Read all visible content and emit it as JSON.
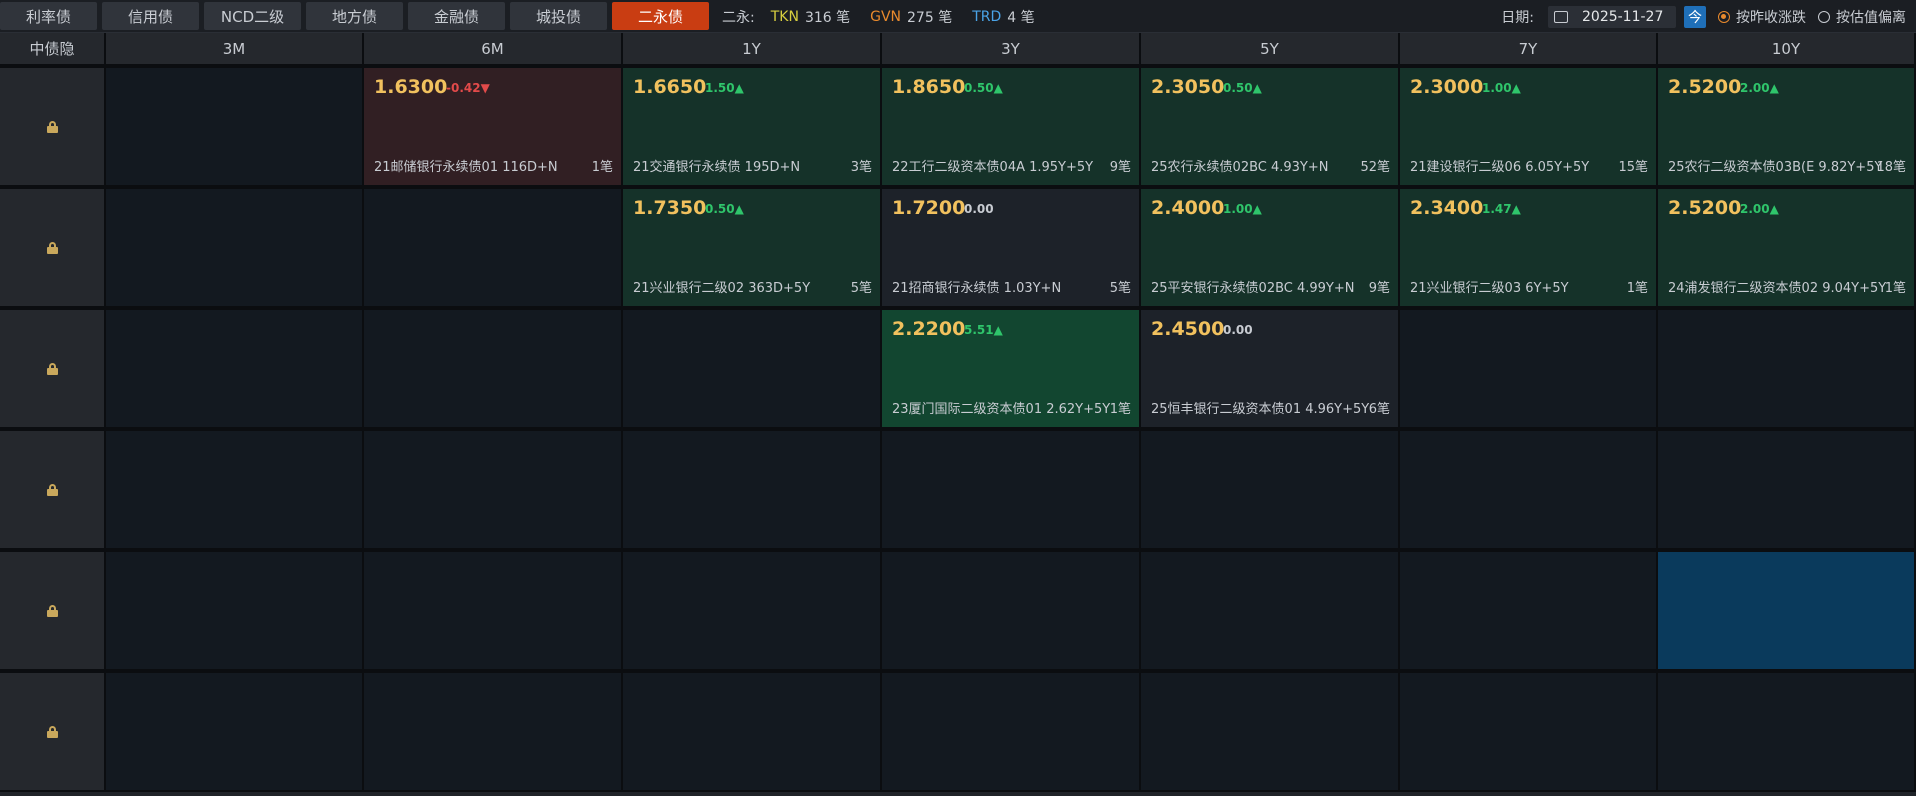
{
  "tabs": [
    "利率债",
    "信用债",
    "NCD二级",
    "地方债",
    "金融债",
    "城投债",
    "二永债"
  ],
  "active_tab": "二永债",
  "summary": {
    "label": "二永:",
    "tkn_key": "TKN",
    "tkn_val": "316 笔",
    "gvn_key": "GVN",
    "gvn_val": "275 笔",
    "trd_key": "TRD",
    "trd_val": "4 笔"
  },
  "date": {
    "label": "日期:",
    "value": "2025-11-27",
    "today_label": "今"
  },
  "options": [
    {
      "label": "按昨收涨跌",
      "selected": true
    },
    {
      "label": "按估值偏离",
      "selected": false
    }
  ],
  "grid": {
    "corner": "中债隐",
    "columns": [
      "3M",
      "6M",
      "1Y",
      "3Y",
      "5Y",
      "7Y",
      "10Y"
    ],
    "rows": [
      {
        "cells": [
          null,
          {
            "rate": "1.6300",
            "change": "-0.42▼",
            "dir": "down",
            "bond": "21邮储银行永续债01 116D+N",
            "count": "1笔"
          },
          {
            "rate": "1.6650",
            "change": "1.50▲",
            "dir": "up",
            "bond": "21交通银行永续债 195D+N",
            "count": "3笔"
          },
          {
            "rate": "1.8650",
            "change": "0.50▲",
            "dir": "up",
            "bond": "22工行二级资本债04A 1.95Y+5Y",
            "count": "9笔"
          },
          {
            "rate": "2.3050",
            "change": "0.50▲",
            "dir": "up",
            "bond": "25农行永续债02BC 4.93Y+N",
            "count": "52笔"
          },
          {
            "rate": "2.3000",
            "change": "1.00▲",
            "dir": "up",
            "bond": "21建设银行二级06 6.05Y+5Y",
            "count": "15笔"
          },
          {
            "rate": "2.5200",
            "change": "2.00▲",
            "dir": "up",
            "bond": "25农行二级资本债03B(E 9.82Y+5Y",
            "count": "18笔"
          }
        ]
      },
      {
        "cells": [
          null,
          null,
          {
            "rate": "1.7350",
            "change": "0.50▲",
            "dir": "up",
            "bond": "21兴业银行二级02 363D+5Y",
            "count": "5笔"
          },
          {
            "rate": "1.7200",
            "change": "0.00",
            "dir": "flat",
            "bond": "21招商银行永续债 1.03Y+N",
            "count": "5笔"
          },
          {
            "rate": "2.4000",
            "change": "1.00▲",
            "dir": "up",
            "bond": "25平安银行永续债02BC 4.99Y+N",
            "count": "9笔"
          },
          {
            "rate": "2.3400",
            "change": "1.47▲",
            "dir": "up",
            "bond": "21兴业银行二级03 6Y+5Y",
            "count": "1笔"
          },
          {
            "rate": "2.5200",
            "change": "2.00▲",
            "dir": "up",
            "bond": "24浦发银行二级资本债02 9.04Y+5Y",
            "count": "1笔"
          }
        ]
      },
      {
        "cells": [
          null,
          null,
          null,
          {
            "rate": "2.2200",
            "change": "5.51▲",
            "dir": "upstrong",
            "bond": "23厦门国际二级资本债01 2.62Y+5Y",
            "count": "1笔"
          },
          {
            "rate": "2.4500",
            "change": "0.00",
            "dir": "flat",
            "bond": "25恒丰银行二级资本债01 4.96Y+5Y",
            "count": "6笔"
          },
          null,
          null
        ]
      },
      {
        "cells": [
          null,
          null,
          null,
          null,
          null,
          null,
          null
        ]
      },
      {
        "cells": [
          null,
          null,
          null,
          null,
          null,
          null,
          "selected"
        ]
      },
      {
        "cells": [
          null,
          null,
          null,
          null,
          null,
          null,
          null
        ]
      }
    ]
  },
  "colors": {
    "active_tab": "#c93d12",
    "up": "#2fc56b",
    "down": "#e24a4a",
    "rate": "#f1c15e"
  }
}
